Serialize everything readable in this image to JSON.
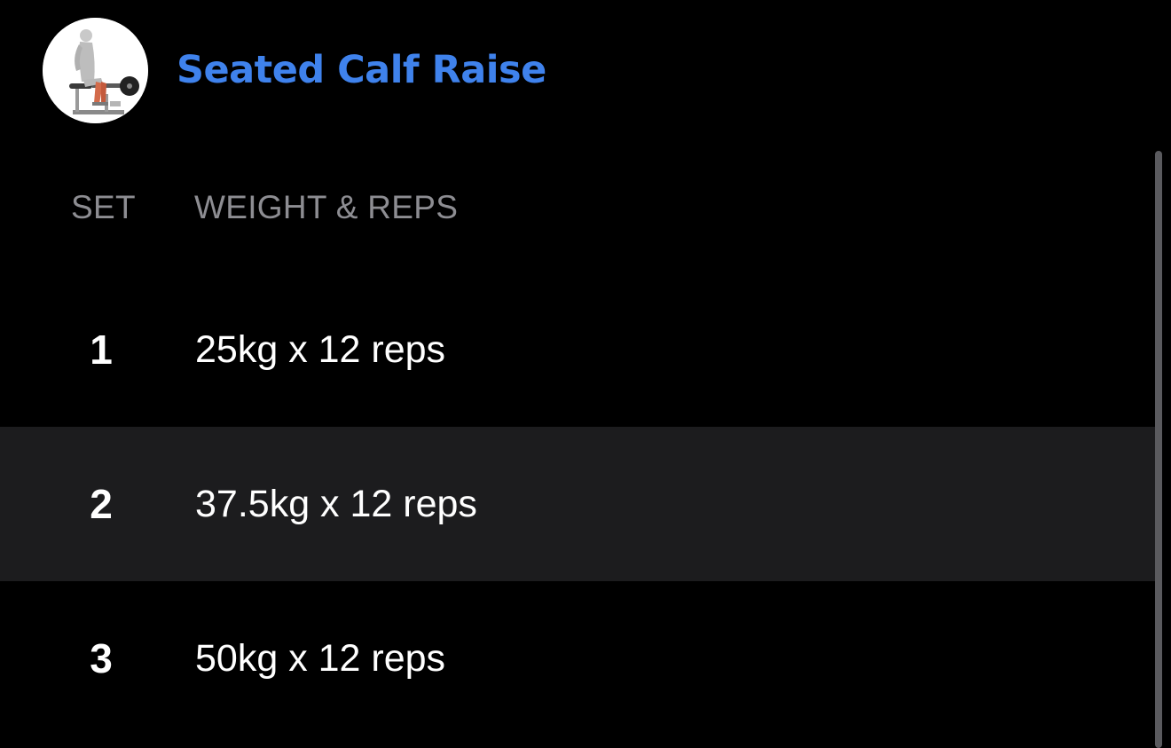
{
  "exercise": {
    "name": "Seated Calf Raise",
    "thumbnail_icon": "seated-calf-raise-illustration",
    "accent_color": "#3f82ec"
  },
  "columns": {
    "set": "SET",
    "weight_reps": "WEIGHT & REPS"
  },
  "sets": [
    {
      "number": "1",
      "detail": "25kg x 12 reps"
    },
    {
      "number": "2",
      "detail": "37.5kg x 12 reps"
    },
    {
      "number": "3",
      "detail": "50kg x 12 reps"
    }
  ],
  "colors": {
    "background": "#000000",
    "row_highlight": "#1c1c1e",
    "header_text": "#8d8d92"
  }
}
